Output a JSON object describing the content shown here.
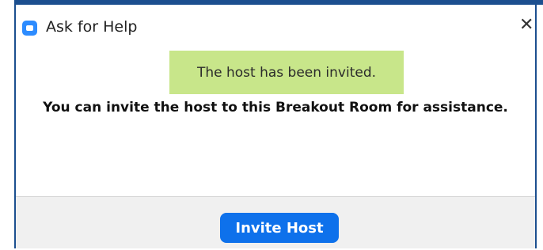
{
  "window": {
    "title": "Ask for Help",
    "app_icon": "zoom-app-icon",
    "close_glyph": "✕"
  },
  "toast": {
    "text": "The host has been invited."
  },
  "main": {
    "message": "You can invite the host to this Breakout Room for assistance."
  },
  "footer": {
    "invite_button_label": "Invite Host"
  },
  "colors": {
    "accent": "#0e71eb",
    "toast_background": "#c8e68a",
    "window_border": "#1c4f8f"
  }
}
